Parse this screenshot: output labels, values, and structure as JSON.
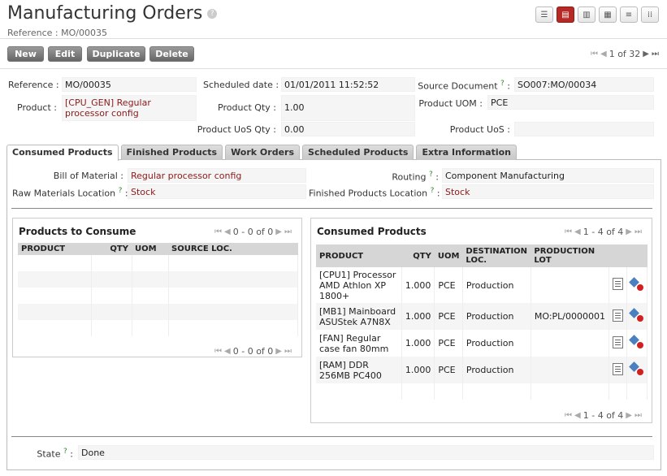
{
  "header": {
    "title": "Manufacturing Orders",
    "help": "?",
    "reference": "Reference : MO/00035",
    "view_icons": [
      "list-view-icon",
      "form-view-icon",
      "graph-view-icon",
      "calendar-view-icon",
      "gantt-view-icon",
      "kanban-view-icon"
    ]
  },
  "toolbar": {
    "new": "New",
    "edit": "Edit",
    "duplicate": "Duplicate",
    "delete": "Delete",
    "pager": "1 of 32"
  },
  "form": {
    "reference_label": "Reference :",
    "reference_value": "MO/00035",
    "scheduled_label": "Scheduled date :",
    "scheduled_value": "01/01/2011 11:52:52",
    "source_label": "Source Document",
    "source_value": "SO007:MO/00034",
    "product_label": "Product :",
    "product_value": "[CPU_GEN] Regular processor config",
    "qty_label": "Product Qty :",
    "qty_value": "1.00",
    "uom_label": "Product UOM :",
    "uom_value": "PCE",
    "uos_qty_label": "Product UoS Qty :",
    "uos_qty_value": "0.00",
    "uos_label": "Product UoS :",
    "uos_value": ""
  },
  "tabs": [
    "Consumed Products",
    "Finished Products",
    "Work Orders",
    "Scheduled Products",
    "Extra Information"
  ],
  "consumed": {
    "bom_label": "Bill of Material :",
    "bom_value": "Regular processor config",
    "routing_label": "Routing",
    "routing_value": "Component Manufacturing",
    "raw_loc_label": "Raw Materials Location",
    "raw_loc_value": "Stock",
    "fin_loc_label": "Finished Products Location",
    "fin_loc_value": "Stock"
  },
  "to_consume": {
    "title": "Products to Consume",
    "pager": "0 - 0 of 0",
    "columns": [
      "PRODUCT",
      "QTY",
      "UOM",
      "SOURCE LOC."
    ]
  },
  "consumed_products": {
    "title": "Consumed Products",
    "pager": "1 - 4 of 4",
    "columns": [
      "PRODUCT",
      "QTY",
      "UOM",
      "DESTINATION LOC.",
      "PRODUCTION LOT"
    ],
    "rows": [
      {
        "product": "[CPU1] Processor AMD Athlon XP 1800+",
        "qty": "1.000",
        "uom": "PCE",
        "dest": "Production",
        "lot": ""
      },
      {
        "product": "[MB1] Mainboard ASUStek A7N8X",
        "qty": "1.000",
        "uom": "PCE",
        "dest": "Production",
        "lot": "MO:PL/0000001"
      },
      {
        "product": "[FAN] Regular case fan 80mm",
        "qty": "1.000",
        "uom": "PCE",
        "dest": "Production",
        "lot": ""
      },
      {
        "product": "[RAM] DDR 256MB PC400",
        "qty": "1.000",
        "uom": "PCE",
        "dest": "Production",
        "lot": ""
      }
    ]
  },
  "state": {
    "label": "State",
    "value": "Done"
  },
  "colors": {
    "accent": "#b52a24",
    "link": "#8b1a1a",
    "help_green": "#2a8a2a"
  }
}
